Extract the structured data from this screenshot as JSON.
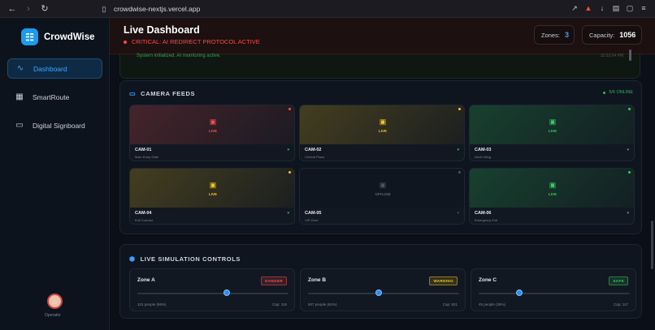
{
  "browser": {
    "url": "crowdwise-nextjs.vercel.app",
    "back_icon": "back-arrow-icon",
    "forward_icon": "forward-arrow-icon",
    "reload_icon": "reload-icon"
  },
  "sidebar": {
    "brand": "CrowdWise",
    "items": [
      {
        "label": "Dashboard",
        "icon": "activity-icon",
        "active": true
      },
      {
        "label": "SmartRoute",
        "icon": "map-icon",
        "active": false
      },
      {
        "label": "Digital Signboard",
        "icon": "monitor-icon",
        "active": false
      }
    ],
    "user_label": "Operator"
  },
  "header": {
    "title": "Live Dashboard",
    "alert": "CRITICAL: AI REDIRECT PROTOCOL ACTIVE",
    "zones_label": "Zones:",
    "zones_value": "3",
    "capacity_label": "Capacity:",
    "capacity_value": "1056"
  },
  "log": {
    "message": "System initialized. AI monitoring active.",
    "time": "10:52:04 PM"
  },
  "camera_feeds": {
    "title": "CAMERA FEEDS",
    "online": "5/6 ONLINE",
    "cams": [
      {
        "id": "CAM-01",
        "location": "Main Entry Gate",
        "status": "LIVE",
        "color": "#ff4d4d"
      },
      {
        "id": "CAM-02",
        "location": "Central Plaza",
        "status": "LIVE",
        "color": "#f5c518"
      },
      {
        "id": "CAM-03",
        "location": "North Wing",
        "status": "LIVE",
        "color": "#2fd05f"
      },
      {
        "id": "CAM-04",
        "location": "Exit Corridor",
        "status": "LIVE",
        "color": "#f5c518"
      },
      {
        "id": "CAM-05",
        "location": "VIP Zone",
        "status": "OFFLINE",
        "color": "#4b5563"
      },
      {
        "id": "CAM-06",
        "location": "Emergency Exit",
        "status": "LIVE",
        "color": "#2fd05f"
      }
    ]
  },
  "simulation": {
    "title": "LIVE SIMULATION CONTROLS",
    "zones": [
      {
        "name": "Zone A",
        "badge": "DANGER",
        "badge_color": "#ff4d4d",
        "people": "101 people (86%)",
        "cap": "Cap: 118",
        "level": 0.59
      },
      {
        "name": "Zone B",
        "badge": "WARNING",
        "badge_color": "#f5c518",
        "people": "507 people (62%)",
        "cap": "Cap: 821",
        "level": 0.47
      },
      {
        "name": "Zone C",
        "badge": "SAFE",
        "badge_color": "#2fd05f",
        "people": "45 people (39%)",
        "cap": "Cap: 117",
        "level": 0.27
      }
    ]
  }
}
